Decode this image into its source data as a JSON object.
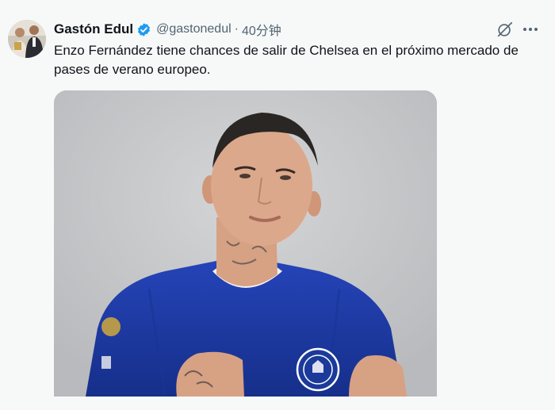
{
  "tweet": {
    "author_name": "Gastón Edul",
    "handle": "@gastonedul",
    "separator": "·",
    "time": "40分钟",
    "text": "Enzo Fernández tiene chances de salir de Chelsea en el próximo mercado de pases de verano europeo.",
    "verified": true
  },
  "icons": {
    "verified": "verified-badge-icon",
    "grok": "grok-icon",
    "more": "more-options-icon"
  },
  "colors": {
    "background": "#f7f9f9",
    "text_primary": "#0f1419",
    "text_secondary": "#536471",
    "verified_blue": "#1d9bf0",
    "jersey_blue": "#1f3fa8"
  }
}
